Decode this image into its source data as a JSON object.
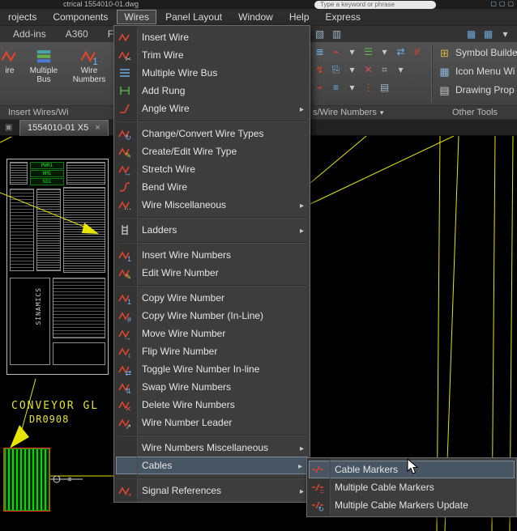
{
  "colors": {
    "canvas_line_yellow": "#e6e600",
    "caption_yellow": "#e3e32a",
    "component_green": "#00dd00",
    "component_red_border": "#ff2a2a",
    "menu_highlight": "#485663",
    "wire_icon_red": "#e2442b",
    "number_icon_blue": "#6fb1e8"
  },
  "titlebar": {
    "filename": "ctrical  1554010-01.dwg",
    "search_placeholder": "Type a keyword or phrase",
    "icons": [
      {
        "name": "minimize-icon",
        "glyph": "▢",
        "color": "#9fb6c9"
      },
      {
        "name": "restore-icon",
        "glyph": "▢",
        "color": "#9fb6c9"
      },
      {
        "name": "close-icon",
        "glyph": "▢",
        "color": "#9fb6c9"
      }
    ]
  },
  "menubar": {
    "items": [
      {
        "label": "rojects"
      },
      {
        "label": "Components"
      },
      {
        "label": "Wires",
        "active": true
      },
      {
        "label": "Panel Layout"
      },
      {
        "label": "Window"
      },
      {
        "label": "Help"
      },
      {
        "label": "Express"
      }
    ]
  },
  "ribbon_tabs": {
    "items": [
      {
        "label": "Add-ins"
      },
      {
        "label": "A360"
      },
      {
        "label": "Fea"
      }
    ],
    "left_icons": [
      {
        "name": "panel-icon",
        "glyph": "▧",
        "color": "#9fb6c9"
      },
      {
        "name": "clipboard-icon",
        "glyph": "▥",
        "color": "#9fb6c9"
      }
    ],
    "right_icons": [
      {
        "name": "view-grid-icon",
        "glyph": "▦",
        "color": "#6fa8dc"
      },
      {
        "name": "view-grid-icon",
        "glyph": "▦",
        "color": "#6fa8dc"
      },
      {
        "name": "dropdown-arrow-icon",
        "glyph": "▾",
        "color": "#c8c8c8"
      }
    ]
  },
  "ribbon": {
    "big_buttons": [
      {
        "label": "ire",
        "icon": "insert-wire-icon"
      },
      {
        "label": "Multiple Bus",
        "icon": "multiple-bus-big-icon"
      },
      {
        "label": "Wire Numbers",
        "icon": "wire-numbers-icon"
      }
    ],
    "small_icon_rows": [
      [
        {
          "name": "multiple-bus-icon",
          "glyph": "≣",
          "color": "#6fb1e8"
        },
        {
          "name": "wire-icon",
          "glyph": "⌁",
          "color": "#e2442b"
        },
        {
          "name": "dropdown-arrow-icon",
          "glyph": "▾",
          "color": "#c8c8c8"
        },
        {
          "name": "ladder-icon",
          "glyph": "☰",
          "color": "#57b847"
        },
        {
          "name": "dropdown-arrow-icon",
          "glyph": "▾",
          "color": "#c8c8c8"
        },
        {
          "name": "swap-arrows-icon",
          "glyph": "⇄",
          "color": "#6fb1e8"
        },
        {
          "name": "wire-number-icon",
          "glyph": "#",
          "color": "#e2442b"
        }
      ],
      [
        {
          "name": "wire-arrow-icon",
          "glyph": "↯",
          "color": "#e2442b"
        },
        {
          "name": "copy-icon",
          "glyph": "⎘",
          "color": "#6fb1e8"
        },
        {
          "name": "dropdown-arrow-icon",
          "glyph": "▾",
          "color": "#c8c8c8"
        },
        {
          "name": "delete-icon",
          "glyph": "✕",
          "color": "#d05454"
        },
        {
          "name": "grid-icon",
          "glyph": "⌗",
          "color": "#bdbdbd"
        },
        {
          "name": "dropdown-arrow-icon",
          "glyph": "▾",
          "color": "#c8c8c8"
        }
      ],
      [
        {
          "name": "cable-icon",
          "glyph": "⌁",
          "color": "#e2442b"
        },
        {
          "name": "bus-lines-icon",
          "glyph": "≡",
          "color": "#6fb1e8"
        },
        {
          "name": "dropdown-arrow-icon",
          "glyph": "▾",
          "color": "#c8c8c8"
        },
        {
          "name": "markers-icon",
          "glyph": "⋮",
          "color": "#e2442b"
        },
        {
          "name": "sheet-icon",
          "glyph": "▤",
          "color": "#9fb6c9"
        }
      ]
    ],
    "other_tools": [
      {
        "label": "Symbol Builder",
        "icon": "symbol-builder-icon",
        "glyph": "⊞",
        "color": "#d9b44a"
      },
      {
        "label": "Icon Menu  Wi",
        "icon": "icon-menu-icon",
        "glyph": "▦",
        "color": "#8fb3d9"
      },
      {
        "label": "Drawing Prop",
        "icon": "drawing-properties-icon",
        "glyph": "▤",
        "color": "#c9c9c9"
      }
    ],
    "group_labels": {
      "left": "Insert Wires/Wi",
      "mid": "s/Wire Numbers",
      "right": "Other Tools"
    }
  },
  "doc_tabs": {
    "active": "1554010-01 X5",
    "close_glyph": "×"
  },
  "wires_menu": {
    "items": [
      {
        "label": "Insert Wire",
        "icon": "insert-wire-icon"
      },
      {
        "label": "Trim Wire",
        "icon": "trim-wire-icon"
      },
      {
        "label": "Multiple Wire Bus",
        "icon": "multiple-wire-bus-icon"
      },
      {
        "label": "Add Rung",
        "icon": "add-rung-icon"
      },
      {
        "label": "Angle Wire",
        "icon": "angle-wire-icon",
        "submenu": true
      },
      {
        "separator": true
      },
      {
        "label": "Change/Convert Wire Types",
        "icon": "change-wire-type-icon"
      },
      {
        "label": "Create/Edit Wire Type",
        "icon": "edit-wire-type-icon"
      },
      {
        "label": "Stretch Wire",
        "icon": "stretch-wire-icon"
      },
      {
        "label": "Bend Wire",
        "icon": "bend-wire-icon"
      },
      {
        "label": "Wire Miscellaneous",
        "icon": "wire-misc-icon",
        "submenu": true
      },
      {
        "separator": true
      },
      {
        "label": "Ladders",
        "icon": "ladders-icon",
        "submenu": true
      },
      {
        "separator": true
      },
      {
        "label": "Insert Wire Numbers",
        "icon": "insert-wire-numbers-icon"
      },
      {
        "label": "Edit Wire Number",
        "icon": "edit-wire-number-icon"
      },
      {
        "separator": true
      },
      {
        "label": "Copy Wire Number",
        "icon": "copy-wire-number-icon"
      },
      {
        "label": "Copy Wire Number (In-Line)",
        "icon": "copy-wire-number-inline-icon"
      },
      {
        "label": "Move Wire Number",
        "icon": "move-wire-number-icon"
      },
      {
        "label": "Flip Wire Number",
        "icon": "flip-wire-number-icon"
      },
      {
        "label": "Toggle Wire Number In-line",
        "icon": "toggle-wire-number-icon"
      },
      {
        "label": "Swap Wire Numbers",
        "icon": "swap-wire-numbers-icon"
      },
      {
        "label": "Delete Wire Numbers",
        "icon": "delete-wire-numbers-icon"
      },
      {
        "label": "Wire Number Leader",
        "icon": "wire-number-leader-icon"
      },
      {
        "separator": true
      },
      {
        "label": "Wire Numbers Miscellaneous",
        "icon": "",
        "submenu": true
      },
      {
        "label": "Cables",
        "icon": "",
        "submenu": true,
        "highlighted": true
      },
      {
        "separator": true
      },
      {
        "label": "Signal References",
        "icon": "signal-references-icon",
        "submenu": true
      }
    ]
  },
  "cables_submenu": {
    "items": [
      {
        "label": "Cable Markers",
        "icon": "cable-marker-icon",
        "highlighted": true
      },
      {
        "label": "Multiple Cable Markers",
        "icon": "multiple-cable-markers-icon"
      },
      {
        "label": "Multiple Cable Markers Update",
        "icon": "multiple-cable-markers-update-icon"
      }
    ]
  },
  "canvas": {
    "panel_labels": [
      {
        "text": "PWR1"
      },
      {
        "text": "HM1"
      },
      {
        "text": "SD1"
      }
    ],
    "vertical_label": "SINAMICS",
    "caption_line1": "CONVEYOR  GL",
    "caption_line2": "DR0908"
  }
}
